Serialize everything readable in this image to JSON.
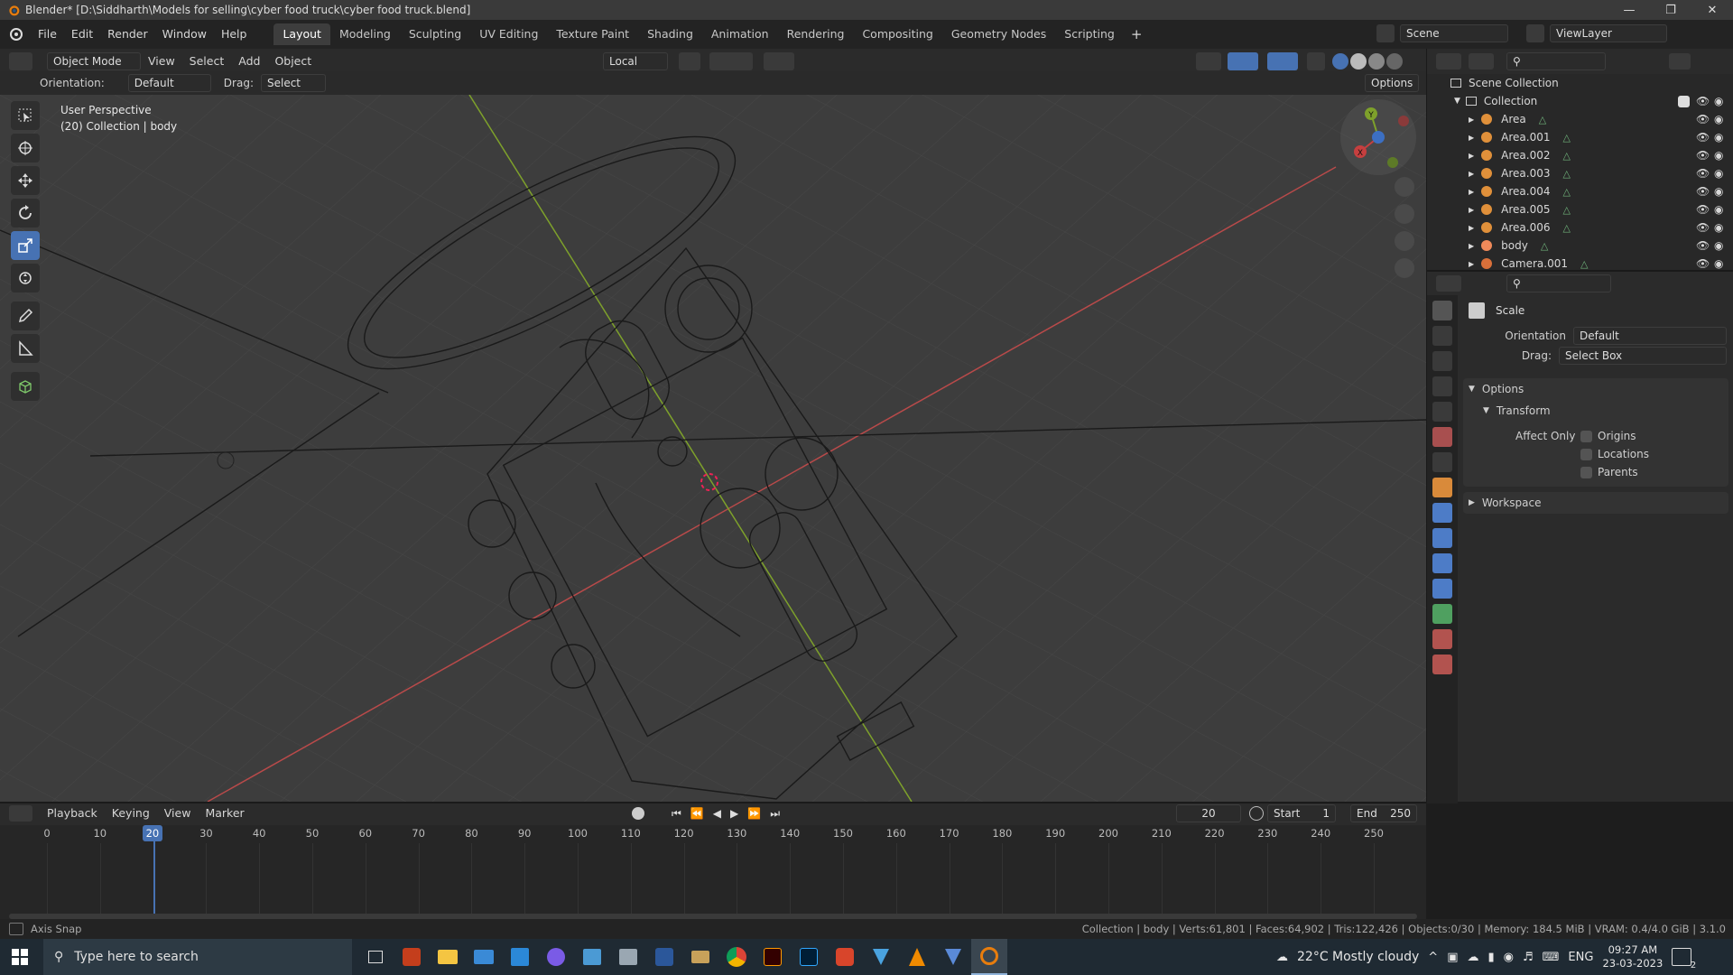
{
  "window": {
    "title": "Blender* [D:\\Siddharth\\Models for selling\\cyber food truck\\cyber food truck.blend]"
  },
  "menus": [
    "File",
    "Edit",
    "Render",
    "Window",
    "Help"
  ],
  "workspaces": [
    "Layout",
    "Modeling",
    "Sculpting",
    "UV Editing",
    "Texture Paint",
    "Shading",
    "Animation",
    "Rendering",
    "Compositing",
    "Geometry Nodes",
    "Scripting"
  ],
  "active_workspace": "Layout",
  "scene": {
    "label": "Scene",
    "view_layer": "ViewLayer"
  },
  "viewport_header": {
    "mode": "Object Mode",
    "menus": [
      "View",
      "Select",
      "Add",
      "Object"
    ],
    "transform_orientation": "Local",
    "options": "Options"
  },
  "tool_settings": {
    "orientation_label": "Orientation:",
    "orientation_value": "Default",
    "drag_label": "Drag:",
    "drag_value": "Select Box"
  },
  "viewport": {
    "overlay_line1": "User Perspective",
    "overlay_line2": "(20) Collection | body",
    "gizmo_axes": {
      "x": "X",
      "y": "Y",
      "z": "Z"
    }
  },
  "outliner": {
    "root": "Scene Collection",
    "collection": "Collection",
    "items": [
      {
        "name": "Area",
        "type": "light"
      },
      {
        "name": "Area.001",
        "type": "light"
      },
      {
        "name": "Area.002",
        "type": "light"
      },
      {
        "name": "Area.003",
        "type": "light"
      },
      {
        "name": "Area.004",
        "type": "light"
      },
      {
        "name": "Area.005",
        "type": "light"
      },
      {
        "name": "Area.006",
        "type": "light"
      },
      {
        "name": "body",
        "type": "mesh"
      },
      {
        "name": "Camera.001",
        "type": "camera"
      }
    ]
  },
  "properties": {
    "tool_name": "Scale",
    "orientation_label": "Orientation",
    "orientation_value": "Default",
    "drag_label": "Drag:",
    "drag_value": "Select Box",
    "options_panel": "Options",
    "transform_panel": "Transform",
    "affect_only_label": "Affect Only",
    "affect_only": [
      "Origins",
      "Locations",
      "Parents"
    ],
    "workspace_panel": "Workspace"
  },
  "timeline": {
    "menus": [
      "Playback",
      "Keying",
      "View",
      "Marker"
    ],
    "current_frame": "20",
    "start_label": "Start",
    "start": "1",
    "end_label": "End",
    "end": "250",
    "ticks": [
      "0",
      "10",
      "20",
      "30",
      "40",
      "50",
      "60",
      "70",
      "80",
      "90",
      "100",
      "110",
      "120",
      "130",
      "140",
      "150",
      "160",
      "170",
      "180",
      "190",
      "200",
      "210",
      "220",
      "230",
      "240",
      "250"
    ]
  },
  "statusbar": {
    "left": "Axis Snap",
    "right": "Collection | body | Verts:61,801 | Faces:64,902 | Tris:122,426 | Objects:0/30 | Memory: 184.5 MiB | VRAM: 0.4/4.0 GiB | 3.1.0"
  },
  "taskbar": {
    "search_placeholder": "Type here to search",
    "weather": "22°C  Mostly cloudy",
    "lang": "ENG",
    "time": "09:27 AM",
    "date": "23-03-2023",
    "notifications": "2"
  },
  "colors": {
    "accent": "#4772b3",
    "axis_red": "#c63f3f",
    "axis_green": "#7ea12b",
    "orange": "#e87d0d"
  }
}
